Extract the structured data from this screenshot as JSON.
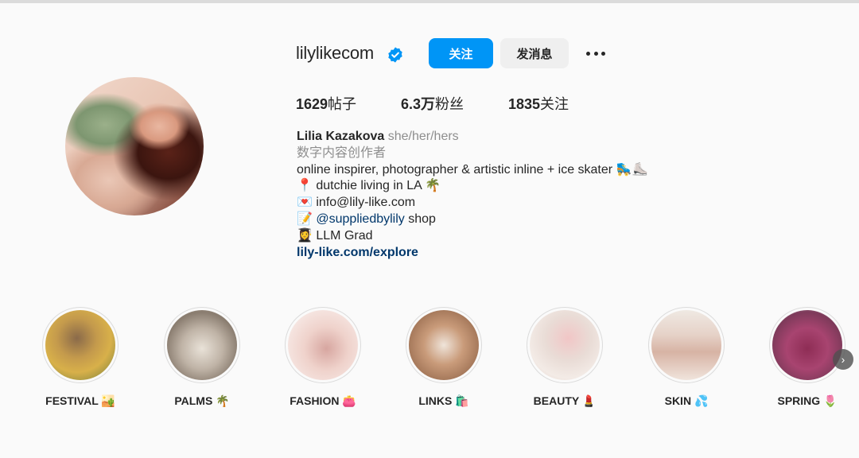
{
  "profile": {
    "username": "lilylikecom",
    "verified_icon": "verified-badge-icon",
    "follow_label": "关注",
    "message_label": "发消息",
    "more_icon": "more-options-icon",
    "accent_color": "#0095f6"
  },
  "stats": {
    "posts_count": "1629",
    "posts_label": "帖子",
    "followers_count": "6.3万",
    "followers_label": "粉丝",
    "following_count": "1835",
    "following_label": "关注"
  },
  "bio": {
    "name": "Lilia Kazakova",
    "pronouns": "she/her/hers",
    "category": "数字内容创作者",
    "line1": "online inspirer, photographer & artistic inline + ice skater 🛼⛸️",
    "line2": "📍 dutchie living in LA 🌴",
    "line3": "💌 info@lily-like.com",
    "line4_prefix": "📝 ",
    "line4_mention": "@suppliedbylily",
    "line4_suffix": " shop",
    "line5": "👩‍🎓 LLM Grad",
    "website": "lily-like.com/explore"
  },
  "highlights": [
    {
      "label": "FESTIVAL 🏜️"
    },
    {
      "label": "PALMS 🌴"
    },
    {
      "label": "FASHION 👛"
    },
    {
      "label": "LINKS 🛍️"
    },
    {
      "label": "BEAUTY 💄"
    },
    {
      "label": "SKIN 💦"
    },
    {
      "label": "SPRING 🌷"
    }
  ],
  "navigation": {
    "next_icon": "chevron-right-icon",
    "next_glyph": "›"
  }
}
